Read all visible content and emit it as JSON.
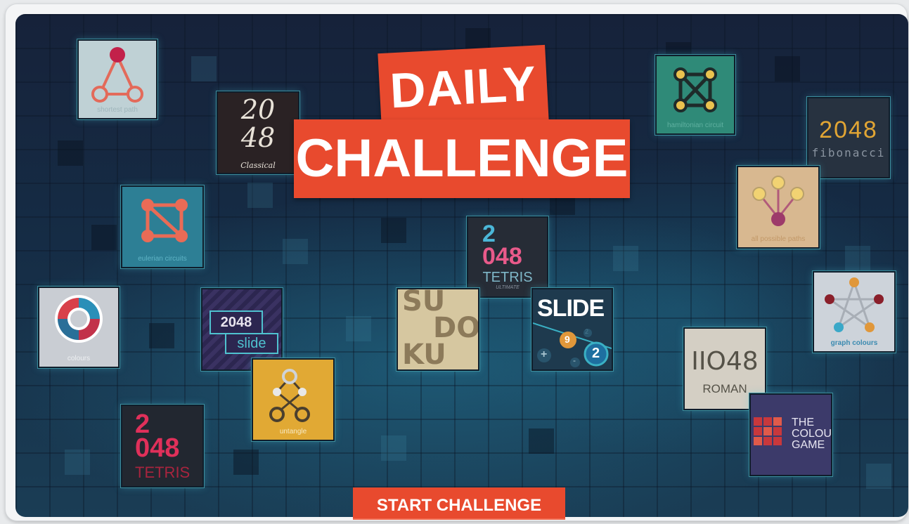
{
  "title": {
    "line1": "DAILY",
    "line2": "CHALLENGE"
  },
  "start_button": "START CHALLENGE",
  "colors": {
    "accent": "#e84a2e",
    "board": "#152c45"
  },
  "games": {
    "shortest_path": {
      "caption": "shortest path",
      "icon": "shortest-path-graph-icon"
    },
    "classical_2048": {
      "line1": "20",
      "line2": "48",
      "subtitle": "Classical"
    },
    "hamiltonian": {
      "caption": "hamiltonian circuit",
      "icon": "hamiltonian-graph-icon"
    },
    "fibonacci": {
      "line1": "2048",
      "line2": "fibonacci"
    },
    "eulerian": {
      "caption": "eulerian circuits",
      "icon": "eulerian-graph-icon"
    },
    "all_paths": {
      "caption": "all possible paths",
      "icon": "tree-graph-icon"
    },
    "tetris_ultimate": {
      "a": "2",
      "b": "048",
      "c": "TETRIS",
      "d": "ULTIMATE"
    },
    "colours": {
      "caption": "colours",
      "icon": "colour-wheel-icon"
    },
    "slide_2048": {
      "line1": "2048",
      "line2": "slide"
    },
    "sudoku": {
      "r1": "SU",
      "r2": "DO",
      "r3": "KU"
    },
    "slide": {
      "title": "SLIDE",
      "n9": "9",
      "n2": "2",
      "plus": "+",
      "minus": "-",
      "small": "2"
    },
    "graph_colours": {
      "caption": "graph colours",
      "icon": "star-graph-icon"
    },
    "roman": {
      "line1": "IIO48",
      "line2": "ROMAN"
    },
    "untangle": {
      "caption": "untangle",
      "icon": "untangle-graph-icon"
    },
    "tetris": {
      "a": "2",
      "b": "048",
      "c": "TETRIS"
    },
    "colour_game": {
      "l1": "THE",
      "l2": "COLOUR",
      "l3": "GAME"
    }
  }
}
